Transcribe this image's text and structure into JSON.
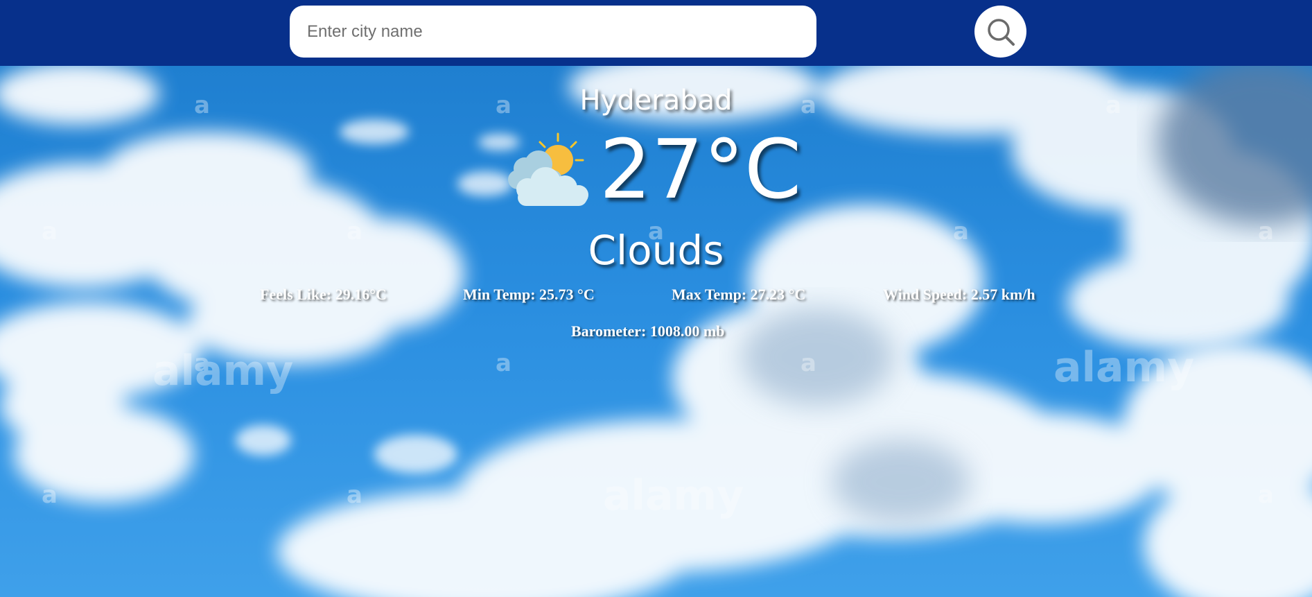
{
  "search": {
    "placeholder": "Enter city name",
    "value": ""
  },
  "icons": {
    "search": "search-icon",
    "weather": "partly-cloudy-icon"
  },
  "colors": {
    "header_bg": "#07308b",
    "text": "#ffffff"
  },
  "weather": {
    "city": "Hyderabad",
    "temperature": "27°C",
    "condition": "Clouds",
    "feels_like": "Feels Like: 29.16°C",
    "min_temp": "Min Temp: 25.73 °C",
    "max_temp": "Max Temp: 27.23 °C",
    "wind_speed": "Wind Speed: 2.57 km/h",
    "barometer": "Barometer: 1008.00 mb"
  }
}
